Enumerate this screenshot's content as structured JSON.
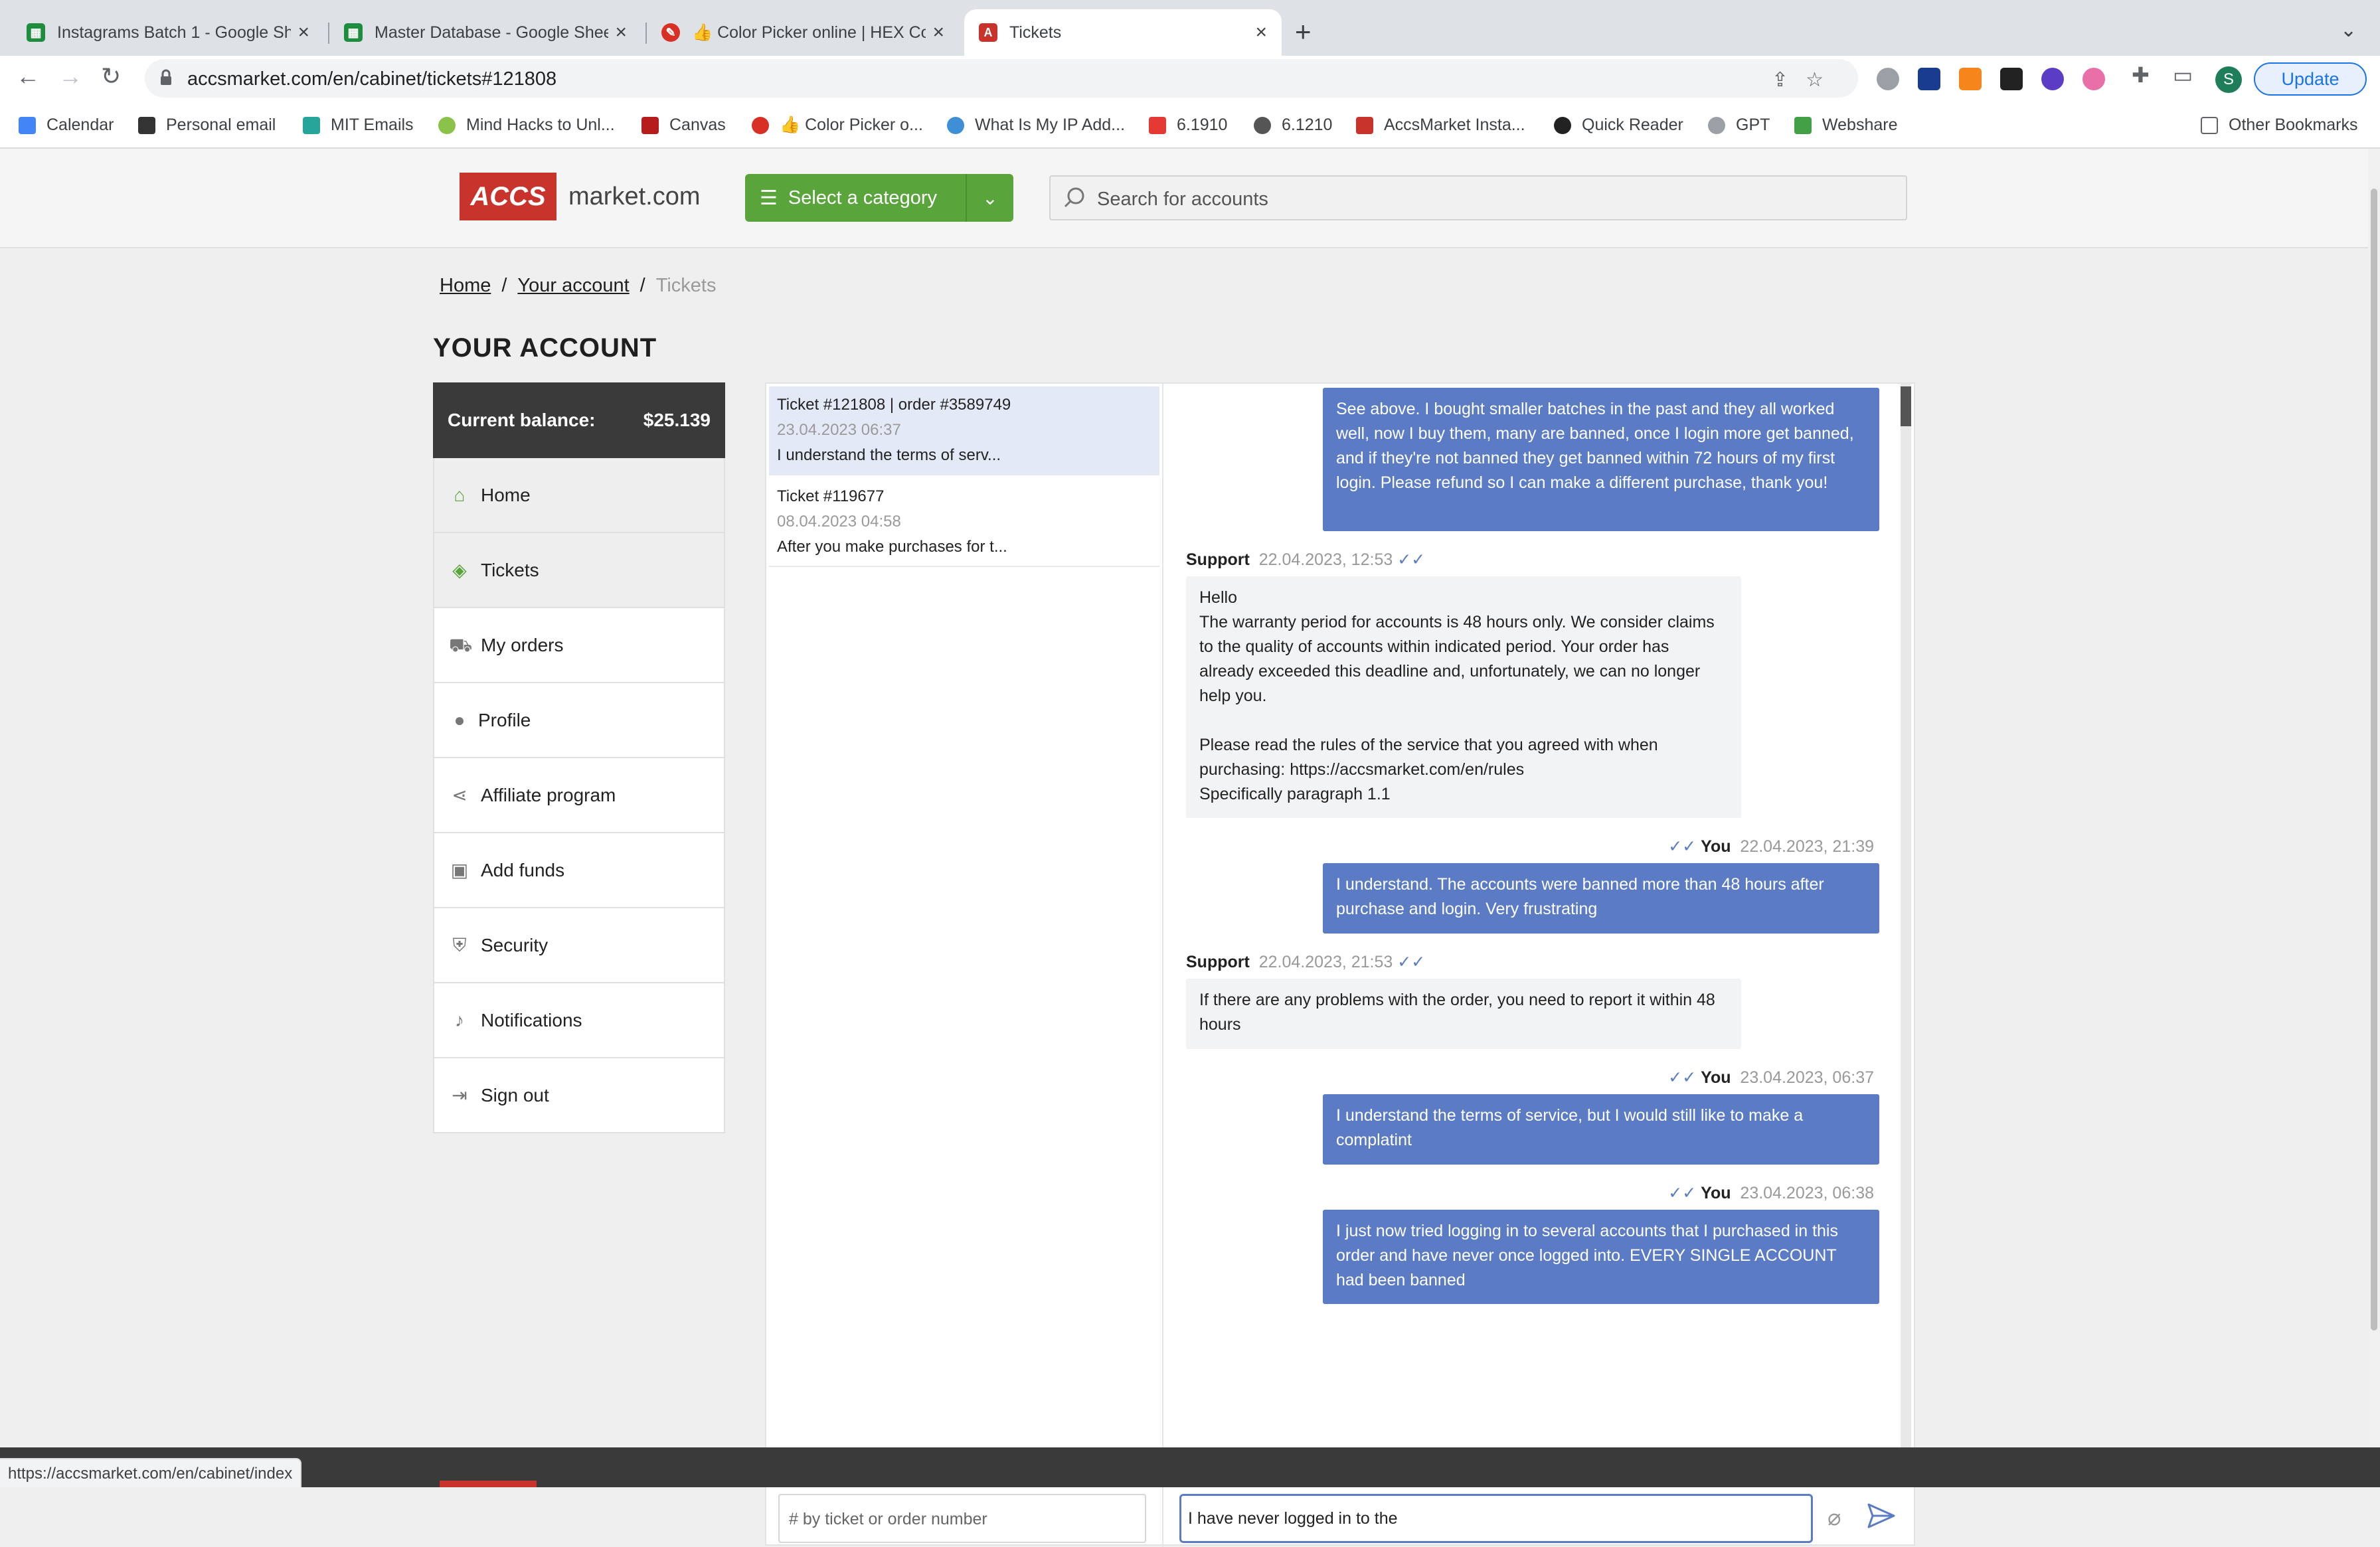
{
  "browser": {
    "tabs": [
      {
        "title": "Instagrams Batch 1 - Google Sh",
        "icon": "sheets-icon",
        "color": "#1e8e3e"
      },
      {
        "title": "Master Database - Google Shee",
        "icon": "sheets-icon",
        "color": "#1e8e3e"
      },
      {
        "title": "👍 Color Picker online | HEX Co",
        "icon": "color-picker-icon",
        "color": "#d93025"
      },
      {
        "title": "Tickets",
        "icon": "accs-icon",
        "color": "#c8332c"
      }
    ],
    "url": "accsmarket.com/en/cabinet/tickets#121808",
    "update_label": "Update",
    "profile_initial": "S",
    "bookmarks": [
      "Calendar",
      "Personal email",
      "MIT Emails",
      "Mind Hacks to Unl...",
      "Canvas",
      "👍 Color Picker o...",
      "What Is My IP Add...",
      "6.1910",
      "6.1210",
      "AccsMarket Insta...",
      "Quick Reader",
      "GPT",
      "Webshare"
    ],
    "other_bookmarks": "Other Bookmarks",
    "status_url": "https://accsmarket.com/en/cabinet/index"
  },
  "site": {
    "logo_badge": "ACCS",
    "logo_text": "market.com",
    "category_label": "Select a category",
    "search_placeholder": "Search for accounts",
    "accent": "#5aa43c",
    "brand": "#c8332c"
  },
  "breadcrumb": {
    "home": "Home",
    "account": "Your account",
    "current": "Tickets"
  },
  "page_title": "YOUR ACCOUNT",
  "sidebar": {
    "balance_label": "Current balance:",
    "balance_value": "$25.139",
    "items": [
      {
        "label": "Home",
        "icon": "home-icon"
      },
      {
        "label": "Tickets",
        "icon": "ticket-icon"
      },
      {
        "label": "My orders",
        "icon": "cart-icon"
      },
      {
        "label": "Profile",
        "icon": "user-icon"
      },
      {
        "label": "Affiliate program",
        "icon": "share-icon"
      },
      {
        "label": "Add funds",
        "icon": "wallet-icon"
      },
      {
        "label": "Security",
        "icon": "shield-icon"
      },
      {
        "label": "Notifications",
        "icon": "bell-icon"
      },
      {
        "label": "Sign out",
        "icon": "sign-out-icon"
      }
    ]
  },
  "tickets": [
    {
      "title": "Ticket #121808 | order #3589749",
      "date": "23.04.2023 06:37",
      "preview": "I understand the terms of serv..."
    },
    {
      "title": "Ticket #119677",
      "date": "08.04.2023 04:58",
      "preview": "After you make purchases for t..."
    }
  ],
  "messages": [
    {
      "author": "",
      "time": "",
      "text": "See above. I bought smaller batches in the past and they all worked well, now I buy them, many are banned, once I login more get banned, and if they're not banned they get banned within 72 hours of my first login. Please refund so I can make a different purchase, thank you!"
    },
    {
      "author": "Support",
      "time": "22.04.2023, 12:53",
      "text": "Hello\nThe warranty period for accounts is 48 hours only. We consider claims to the quality of accounts within indicated period. Your order has already exceeded this deadline and, unfortunately, we can no longer help you.\n\nPlease read the rules of the service that you agreed with when purchasing: https://accsmarket.com/en/rules\nSpecifically paragraph 1.1"
    },
    {
      "author": "You",
      "time": "22.04.2023, 21:39",
      "text": "I understand. The accounts were banned more than 48 hours after purchase and login. Very frustrating"
    },
    {
      "author": "Support",
      "time": "22.04.2023, 21:53",
      "text": "If there are any problems with the order, you need to report it within 48 hours"
    },
    {
      "author": "You",
      "time": "23.04.2023, 06:37",
      "text": "I understand the terms of service, but I would still like to make a complatint"
    },
    {
      "author": "You",
      "time": "23.04.2023, 06:38",
      "text": "I just now tried logging in to several accounts that I purchased in this order and have never once logged into. EVERY SINGLE ACCOUNT had been banned"
    }
  ],
  "ticket_search_placeholder": "# by ticket or order number",
  "message_input_value": "I have never logged in to the"
}
